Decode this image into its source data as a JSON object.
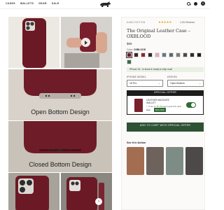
{
  "nav": {
    "items": [
      "CASES",
      "WALLETS",
      "GEAR",
      "SALE"
    ],
    "cart_count": "0"
  },
  "gallery": {
    "caption_open": "Open Bottom Design",
    "caption_closed": "Closed Bottom Design",
    "next_glyph": "›"
  },
  "product": {
    "badge": "HAND EDITION",
    "stars": "★★★★★",
    "reviews": "1,234 Reviews",
    "title": "The Original Leather Case – OXBLOOD",
    "price": "$99",
    "color_prefix": "Color:",
    "color_name": "OXBLOOD",
    "swatches": [
      "#6b1a25",
      "#3a2a22",
      "#8b2a2a",
      "#2b2b2b",
      "#e8a9b8",
      "#5f7a8a",
      "#5a6a6e",
      "#7d7d7d",
      "#4a4a4a",
      "#2d2d2d",
      "#1e1e1e",
      "#3e6b52"
    ],
    "shipping": "iPhone 16 : in stock & ready to ship now!",
    "phone_model_label": "IPHONE MODEL",
    "phone_model_value": "16 Pro",
    "design_label": "DESIGN",
    "design_value": "Open Bottom",
    "special_head": "SPECIAL OFFER",
    "wallet_name": "LEATHER MAGSAFE WALLET",
    "wallet_stock": "✓ 8 out of 10 shoppers grab this deal",
    "wallet_price": "$60",
    "wallet_off": "50% OFF",
    "atc": "ADD TO CART WITH SPECIAL OFFER",
    "see_in_action": "See It in Action"
  },
  "colors": {
    "brand_green": "#2e5234",
    "case_oxblood": "#6b1a25"
  }
}
